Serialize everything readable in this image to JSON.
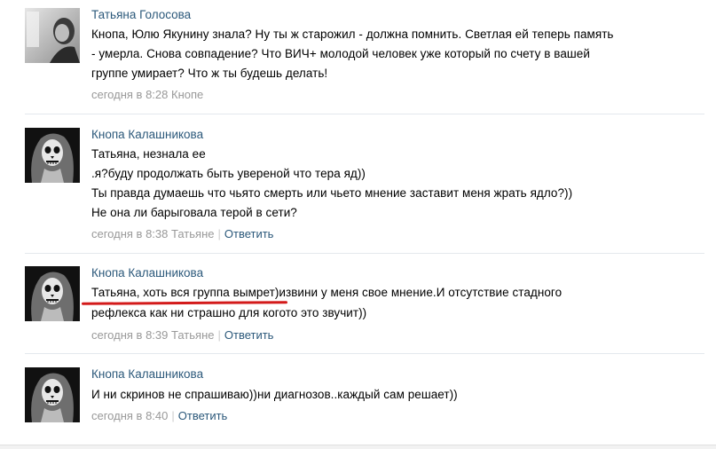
{
  "comments": [
    {
      "author": "Татьяна Голосова",
      "lines": [
        "Кнопа, Юлю Якунину знала? Ну ты ж старожил - должна помнить. Светлая ей теперь память",
        "- умерла. Снова совпадение? Что ВИЧ+ молодой человек уже который по счету в вашей",
        "группе умирает? Что ж ты будешь делать!"
      ],
      "time": "сегодня в 8:28",
      "reply_to": "Кнопе",
      "reply_label": ""
    },
    {
      "author": "Кнопа Калашникова",
      "lines": [
        "Татьяна, незнала ее",
        ".я?буду продолжать быть уверенoй что тера яд))",
        "Ты правда думаешь что чьято смерть или чьето мнение заставит меня жрать ядло?))",
        "Не она ли барыговала терой в сети?"
      ],
      "time": "сегодня в 8:38",
      "reply_to": "Татьяне",
      "reply_label": "Ответить"
    },
    {
      "author": "Кнопа Калашникова",
      "lines": [
        "Татьяна, хоть вся группа вымрет)извини у меня свое мнение.И отсутствие стадного",
        "рефлекса как ни страшно для когото это звучит))"
      ],
      "time": "сегодня в 8:39",
      "reply_to": "Татьяне",
      "reply_label": "Ответить"
    },
    {
      "author": "Кнопа Калашникова",
      "lines": [
        "И ни скринов не спрашиваю))ни диагнозов..каждый сам решает))"
      ],
      "time": "сегодня в 8:40",
      "reply_to": "",
      "reply_label": "Ответить"
    }
  ],
  "colors": {
    "author_link": "#2b587a",
    "meta_text": "#999999",
    "divider": "#e4e8ed",
    "highlight_underline": "#d31a1a"
  },
  "icons": {
    "avatar_1": "woman-photo-avatar",
    "avatar_2_4": "skull-makeup-avatar"
  }
}
